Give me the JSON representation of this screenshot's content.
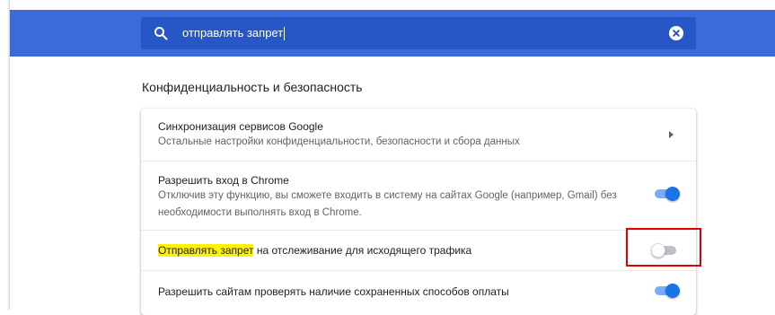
{
  "search": {
    "query": "отправлять запрет"
  },
  "section": {
    "title": "Конфиденциальность и безопасность"
  },
  "rows": [
    {
      "title": "Синхронизация сервисов Google",
      "subtitle": "Остальные настройки конфиденциальности, безопасности и сбора данных"
    },
    {
      "title": "Разрешить вход в Chrome",
      "subtitle_line1": "Отключив эту функцию, вы сможете входить в систему на сайтах Google (например, Gmail) без",
      "subtitle_line2": "необходимости выполнять вход в Chrome.",
      "toggle_on": true
    },
    {
      "title_highlight": "Отправлять запрет",
      "title_rest": " на отслеживание для исходящего трафика",
      "toggle_on": false
    },
    {
      "title": "Разрешить сайтам проверять наличие сохраненных способов оплаты",
      "toggle_on": true
    }
  ],
  "colors": {
    "header": "#3b6bd8",
    "search_box": "#2757c6",
    "toggle_on": "#1a73e8",
    "highlight": "#fff200",
    "annotation_box": "#e00000"
  },
  "icons": {
    "search": "search-icon",
    "clear": "close-icon",
    "arrow": "chevron-right-icon"
  }
}
